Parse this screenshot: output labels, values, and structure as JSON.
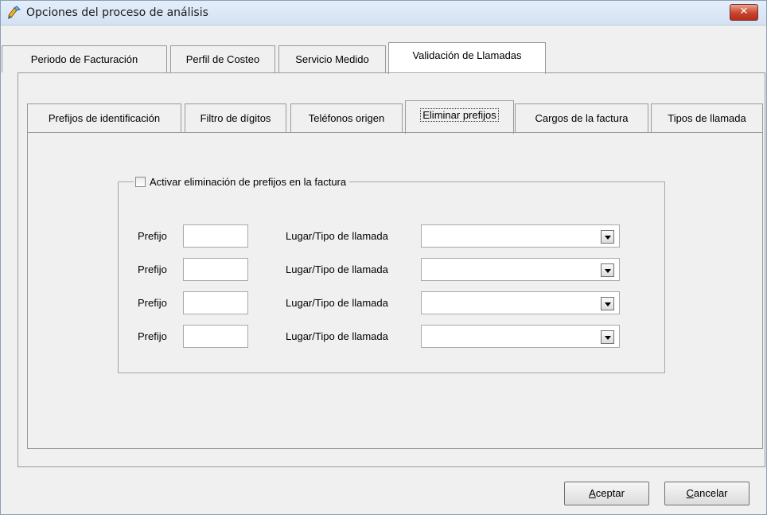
{
  "window": {
    "title": "Opciones del proceso de análisis",
    "close_symbol": "✕"
  },
  "main_tabs": [
    {
      "label": "Periodo de Facturación",
      "selected": false
    },
    {
      "label": "Perfil de Costeo",
      "selected": false
    },
    {
      "label": "Servicio Medido",
      "selected": false
    },
    {
      "label": "Validación de Llamadas",
      "selected": true
    }
  ],
  "sub_tabs": [
    {
      "label": "Prefijos de identificación",
      "selected": false
    },
    {
      "label": "Filtro de dígitos",
      "selected": false
    },
    {
      "label": "Teléfonos origen",
      "selected": false
    },
    {
      "label": "Eliminar prefijos",
      "selected": true
    },
    {
      "label": "Cargos de la factura",
      "selected": false
    },
    {
      "label": "Tipos de llamada",
      "selected": false
    }
  ],
  "group": {
    "checkbox_label": "Activar eliminación de prefijos en la factura",
    "checked": false
  },
  "rows": [
    {
      "prefix_label": "Prefijo",
      "prefix_value": "",
      "place_label": "Lugar/Tipo de llamada",
      "place_value": ""
    },
    {
      "prefix_label": "Prefijo",
      "prefix_value": "",
      "place_label": "Lugar/Tipo de llamada",
      "place_value": ""
    },
    {
      "prefix_label": "Prefijo",
      "prefix_value": "",
      "place_label": "Lugar/Tipo de llamada",
      "place_value": ""
    },
    {
      "prefix_label": "Prefijo",
      "prefix_value": "",
      "place_label": "Lugar/Tipo de llamada",
      "place_value": ""
    }
  ],
  "buttons": {
    "accept": {
      "mnemonic": "A",
      "rest": "ceptar"
    },
    "cancel": {
      "mnemonic": "C",
      "rest": "ancelar"
    }
  },
  "colors": {
    "close_button": "#c8432b",
    "selected_tab": "#ffffff",
    "window_bg": "#f0f0f0"
  }
}
